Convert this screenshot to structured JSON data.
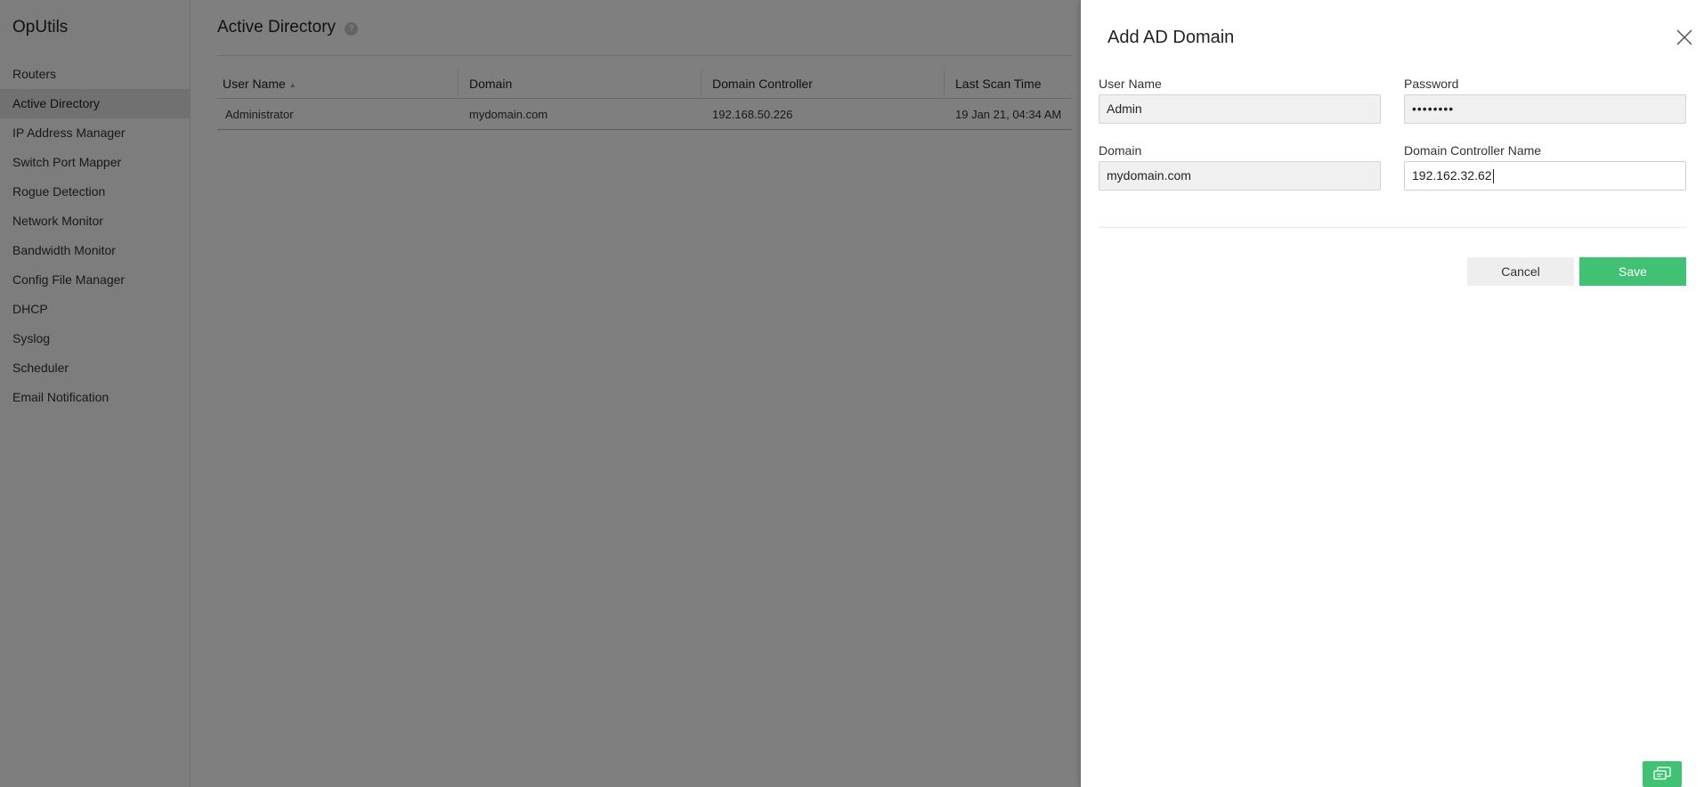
{
  "app": {
    "name": "OpUtils"
  },
  "sidebar": {
    "items": [
      {
        "label": "Routers"
      },
      {
        "label": "Active Directory",
        "active": true
      },
      {
        "label": "IP Address Manager"
      },
      {
        "label": "Switch Port Mapper"
      },
      {
        "label": "Rogue Detection"
      },
      {
        "label": "Network Monitor"
      },
      {
        "label": "Bandwidth Monitor"
      },
      {
        "label": "Config File Manager"
      },
      {
        "label": "DHCP"
      },
      {
        "label": "Syslog"
      },
      {
        "label": "Scheduler"
      },
      {
        "label": "Email Notification"
      }
    ]
  },
  "main": {
    "title": "Active Directory",
    "help_icon": "help-icon",
    "table": {
      "columns": [
        "User Name",
        "Domain",
        "Domain Controller",
        "Last Scan Time"
      ],
      "rows": [
        {
          "user": "Administrator",
          "domain": "mydomain.com",
          "controller": "192.168.50.226",
          "scan": "19 Jan 21, 04:34 AM"
        }
      ]
    }
  },
  "panel": {
    "title": "Add AD Domain",
    "fields": {
      "username": {
        "label": "User Name",
        "value": "Admin"
      },
      "password": {
        "label": "Password",
        "value": "••••••••"
      },
      "domain": {
        "label": "Domain",
        "value": "mydomain.com"
      },
      "controller": {
        "label": "Domain Controller Name",
        "value": "192.162.32.62"
      }
    },
    "buttons": {
      "cancel": "Cancel",
      "save": "Save"
    }
  },
  "colors": {
    "accent": "#40c173",
    "overlay": "#808080",
    "active_nav": "#e2e2e2"
  }
}
